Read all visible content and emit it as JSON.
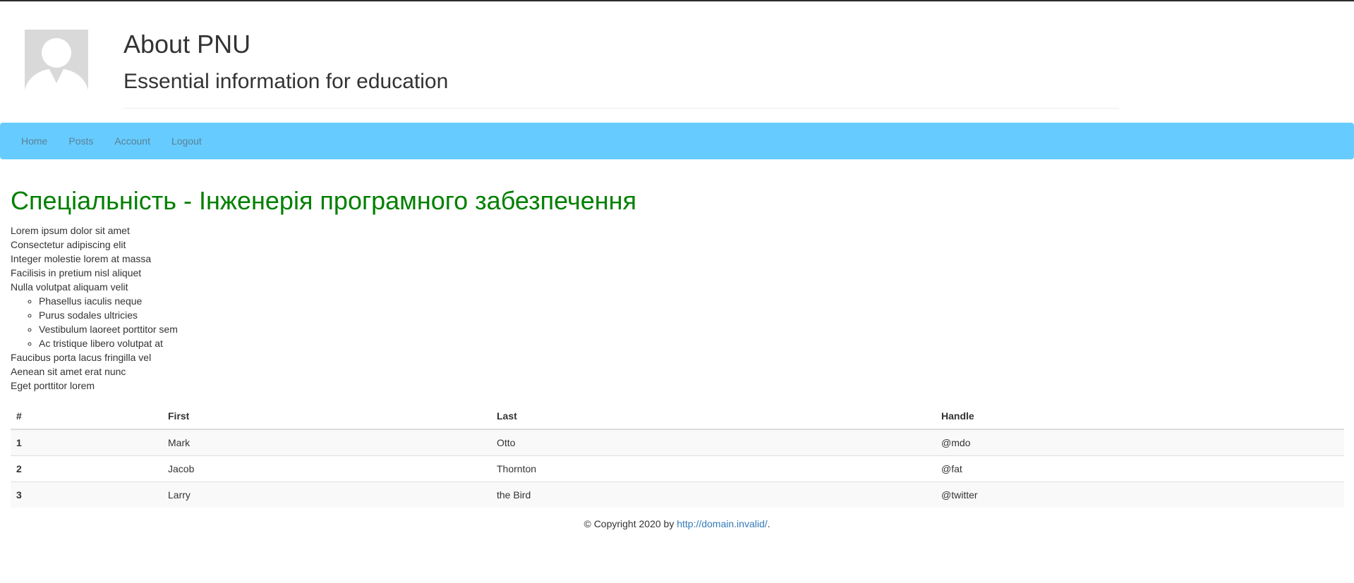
{
  "header": {
    "avatar_icon": "user-avatar-placeholder-icon",
    "title": "About PNU",
    "subtitle": "Essential information for education"
  },
  "nav": {
    "items": [
      {
        "label": "Home"
      },
      {
        "label": "Posts"
      },
      {
        "label": "Account"
      },
      {
        "label": "Logout"
      }
    ]
  },
  "main": {
    "heading": "Спеціальність - Інженерія програмного забезпечення",
    "lines_before": [
      "Lorem ipsum dolor sit amet",
      "Consectetur adipiscing elit",
      "Integer molestie lorem at massa",
      "Facilisis in pretium nisl aliquet",
      "Nulla volutpat aliquam velit"
    ],
    "sublist": [
      "Phasellus iaculis neque",
      "Purus sodales ultricies",
      "Vestibulum laoreet porttitor sem",
      "Ac tristique libero volutpat at"
    ],
    "lines_after": [
      "Faucibus porta lacus fringilla vel",
      "Aenean sit amet erat nunc",
      "Eget porttitor lorem"
    ]
  },
  "table": {
    "headers": [
      "#",
      "First",
      "Last",
      "Handle"
    ],
    "rows": [
      [
        "1",
        "Mark",
        "Otto",
        "@mdo"
      ],
      [
        "2",
        "Jacob",
        "Thornton",
        "@fat"
      ],
      [
        "3",
        "Larry",
        "the Bird",
        "@twitter"
      ]
    ]
  },
  "footer": {
    "copyright": "© Copyright 2020 by",
    "link_text": "http://domain.invalid/",
    "trailing": "."
  },
  "colors": {
    "navbar": "#66ccff",
    "heading": "#008000",
    "link": "#337ab7"
  }
}
